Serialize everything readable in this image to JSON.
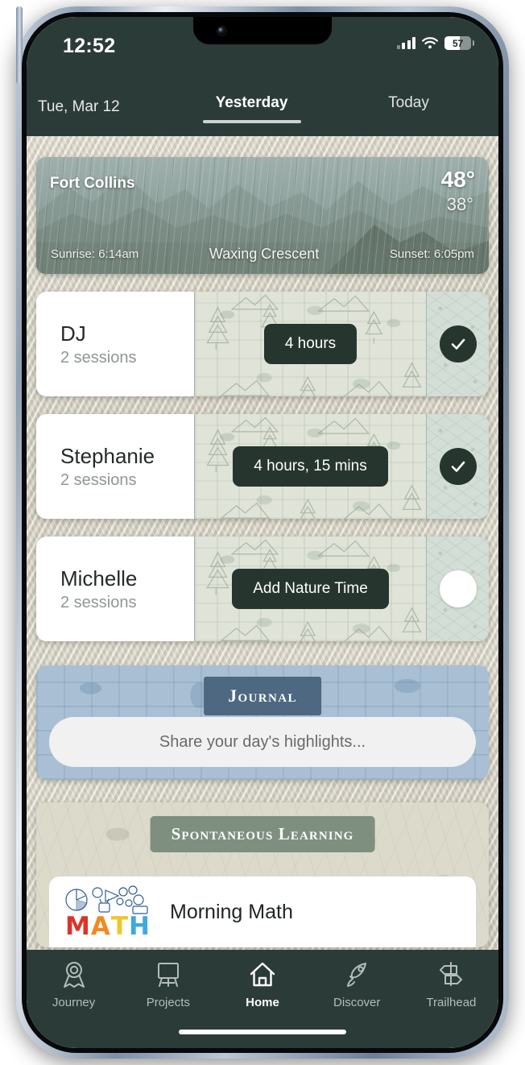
{
  "status_bar": {
    "time": "12:52",
    "battery_level": "57",
    "battery_percent": 57,
    "wifi_icon": "wifi-icon",
    "cellular_icon": "cellular-signal-icon",
    "battery_icon": "battery-icon"
  },
  "header": {
    "date": "Tue, Mar 12",
    "tabs": [
      {
        "label": "Yesterday",
        "active": true
      },
      {
        "label": "Today",
        "active": false
      }
    ]
  },
  "weather": {
    "city": "Fort Collins",
    "high": "48°",
    "low": "38°",
    "sunrise": "Sunrise: 6:14am",
    "moon_phase": "Waxing Crescent",
    "sunset": "Sunset: 6:05pm"
  },
  "people": [
    {
      "name": "DJ",
      "sessions": "2 sessions",
      "time_label": "4 hours",
      "completed": true,
      "status_icon": "check-circle-filled-icon"
    },
    {
      "name": "Stephanie",
      "sessions": "2 sessions",
      "time_label": "4 hours, 15 mins",
      "completed": true,
      "status_icon": "check-circle-filled-icon"
    },
    {
      "name": "Michelle",
      "sessions": "2 sessions",
      "time_label": "Add Nature Time",
      "completed": false,
      "status_icon": "circle-empty-icon"
    }
  ],
  "journal": {
    "title": "Journal",
    "input_placeholder": "Share your day's highlights..."
  },
  "spontaneous_learning": {
    "title": "Spontaneous Learning",
    "items": [
      {
        "title": "Morning Math",
        "logo_text": "MATH",
        "logo_icon": "math-doodle-logo"
      }
    ]
  },
  "tabbar": {
    "items": [
      {
        "label": "Journey",
        "icon": "award-ribbon-icon",
        "active": false
      },
      {
        "label": "Projects",
        "icon": "easel-icon",
        "active": false
      },
      {
        "label": "Home",
        "icon": "house-icon",
        "active": true
      },
      {
        "label": "Discover",
        "icon": "rocket-icon",
        "active": false
      },
      {
        "label": "Trailhead",
        "icon": "signpost-icon",
        "active": false
      }
    ]
  },
  "colors": {
    "app_dark": "#2b3b38",
    "pill_dark": "#27352f",
    "journal_badge": "#4d6880",
    "spont_badge": "#7e8f80",
    "background": "#d6d1c3"
  },
  "math_logo_letters": [
    {
      "ch": "M",
      "color": "#d8352a"
    },
    {
      "ch": "A",
      "color": "#ef8a22"
    },
    {
      "ch": "T",
      "color": "#f3c52c"
    },
    {
      "ch": "H",
      "color": "#3fa9dd"
    }
  ]
}
